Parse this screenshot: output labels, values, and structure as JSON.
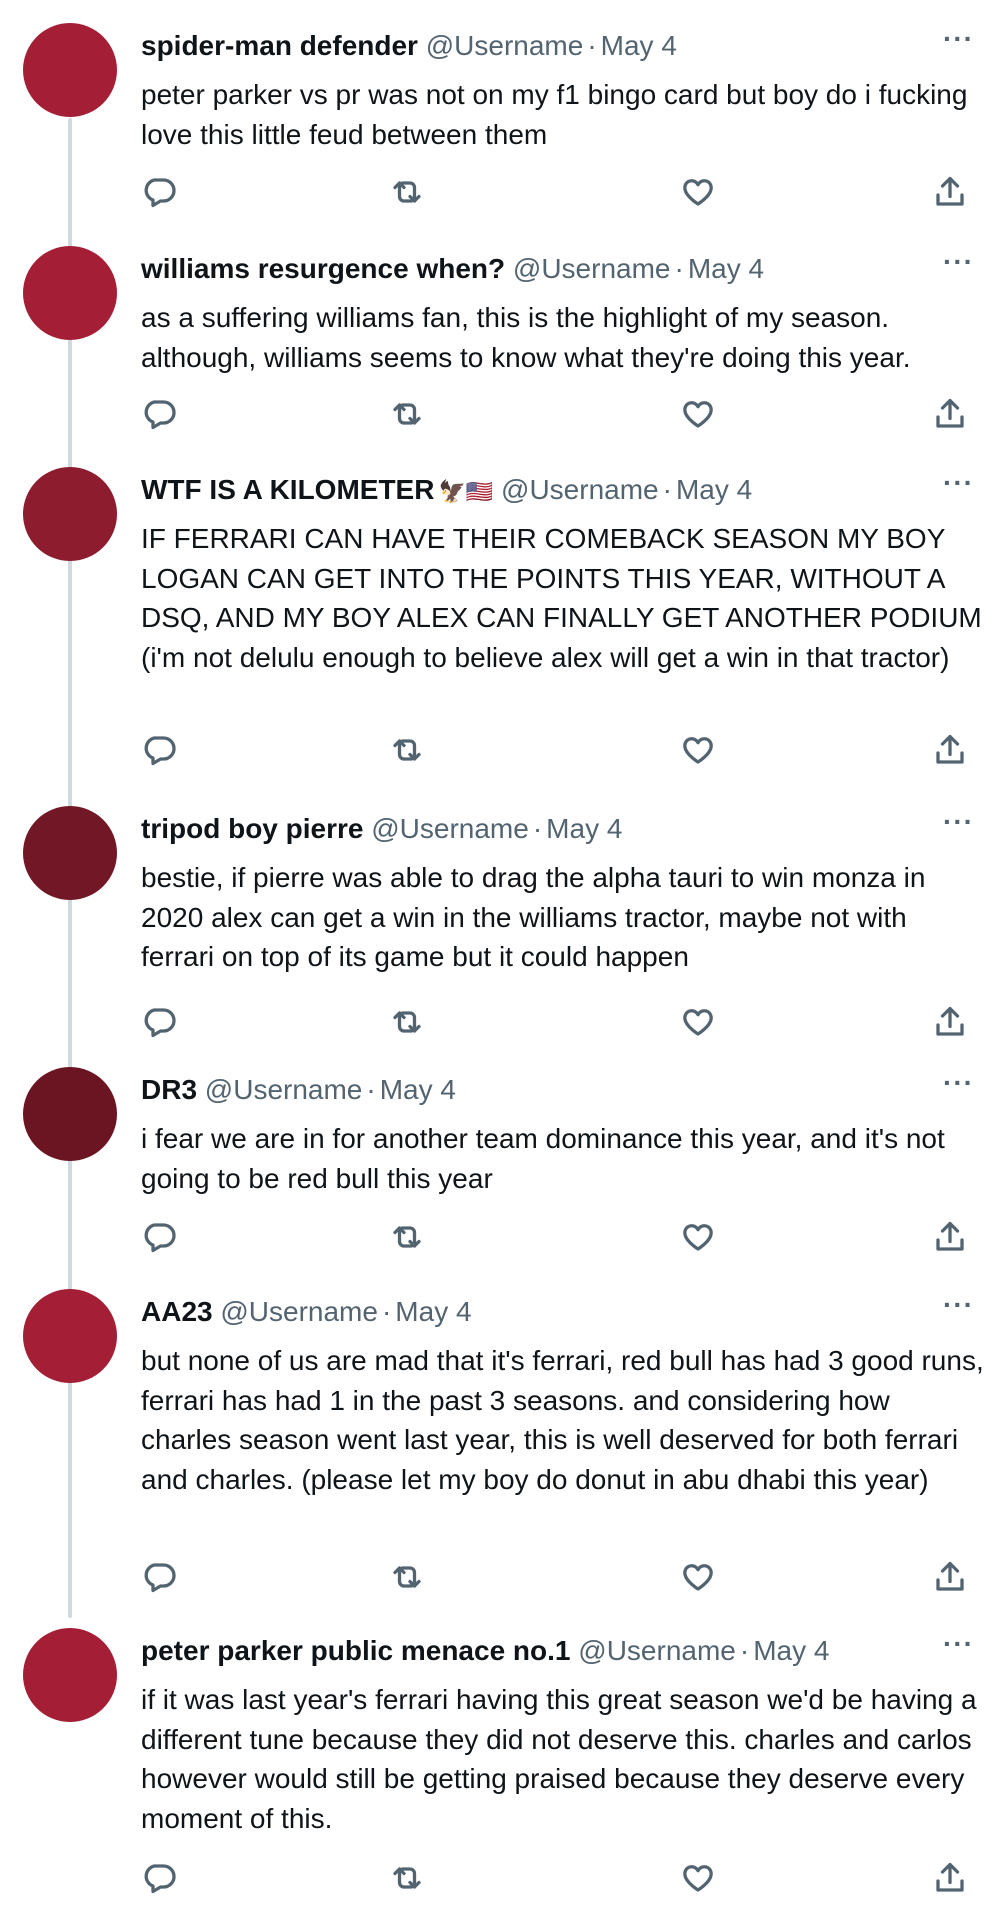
{
  "colors": {
    "text": "#0f1419",
    "secondary": "#536471",
    "thread_line": "#cfd9de"
  },
  "icons": {
    "reply": "reply-icon",
    "retweet": "retweet-icon",
    "like": "heart-icon",
    "share": "share-icon",
    "more": "more-icon"
  },
  "tweets": [
    {
      "name": "spider-man defender",
      "flags": "",
      "handle": "@Username",
      "date": "May 4",
      "text": "peter parker vs pr was not on my f1 bingo card but boy do i fucking love this little feud between them",
      "avatar_color": "#a41e36"
    },
    {
      "name": "williams resurgence when?",
      "flags": "",
      "handle": "@Username",
      "date": "May 4",
      "text": "as a suffering williams fan, this is the highlight of my season. although, williams seems to know what they're doing this year.",
      "avatar_color": "#a41e36"
    },
    {
      "name": "WTF IS A KILOMETER",
      "flags": "🦅🇺🇸",
      "handle": "@Username",
      "date": "May 4",
      "text": "IF FERRARI CAN HAVE THEIR COMEBACK SEASON MY BOY LOGAN CAN GET INTO THE POINTS THIS YEAR, WITHOUT A DSQ, AND MY BOY ALEX CAN FINALLY GET ANOTHER PODIUM (i'm not delulu enough to believe alex will get a win in that tractor)",
      "avatar_color": "#8c1c2e"
    },
    {
      "name": "tripod boy pierre",
      "flags": "",
      "handle": "@Username",
      "date": "May 4",
      "text": "bestie, if pierre was able to drag the alpha tauri to win monza in 2020 alex can get a win in the williams tractor, maybe not with ferrari on top of its game but it could happen",
      "avatar_color": "#711726"
    },
    {
      "name": "DR3",
      "flags": "",
      "handle": "@Username",
      "date": "May 4",
      "text": "i fear we are in for another team dominance this year, and it's not going to be red bull this year",
      "avatar_color": "#6b1523"
    },
    {
      "name": "AA23",
      "flags": "",
      "handle": "@Username",
      "date": "May 4",
      "text": "but none of us are mad that it's ferrari, red bull has had 3 good runs, ferrari has had 1 in the past 3 seasons. and considering how charles season went last year, this is well deserved for both ferrari and charles. (please let my boy do donut in abu dhabi this year)",
      "avatar_color": "#a41e36"
    },
    {
      "name": "peter parker public menace no.1",
      "flags": "",
      "handle": "@Username",
      "date": "May 4",
      "text": "if it was last year's ferrari having this great season we'd be having a different tune because they did not deserve this. charles and carlos however would still be getting praised because they deserve every moment of this.",
      "avatar_color": "#a41e36"
    }
  ]
}
